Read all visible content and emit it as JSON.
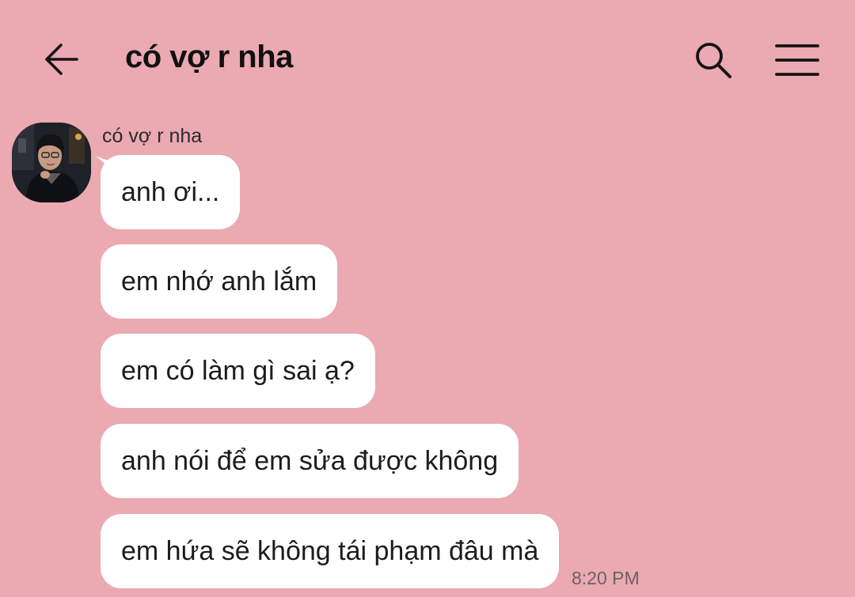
{
  "header": {
    "title": "có vợ r nha",
    "back_icon": "arrow-left-icon",
    "search_icon": "search-icon",
    "menu_icon": "hamburger-menu-icon"
  },
  "chat": {
    "sender_name": "có vợ r nha",
    "avatar_icon": "profile-photo",
    "messages": [
      {
        "text": "anh ơi..."
      },
      {
        "text": "em nhớ anh lắm"
      },
      {
        "text": "em có làm gì sai ạ?"
      },
      {
        "text": "anh nói để em sửa được không"
      },
      {
        "text": "em hứa sẽ không tái phạm đâu mà"
      }
    ],
    "last_timestamp": "8:20 PM"
  },
  "colors": {
    "background": "#eba9b2",
    "bubble": "#ffffff",
    "text": "#1c1c1c",
    "timestamp": "#6c6164"
  }
}
